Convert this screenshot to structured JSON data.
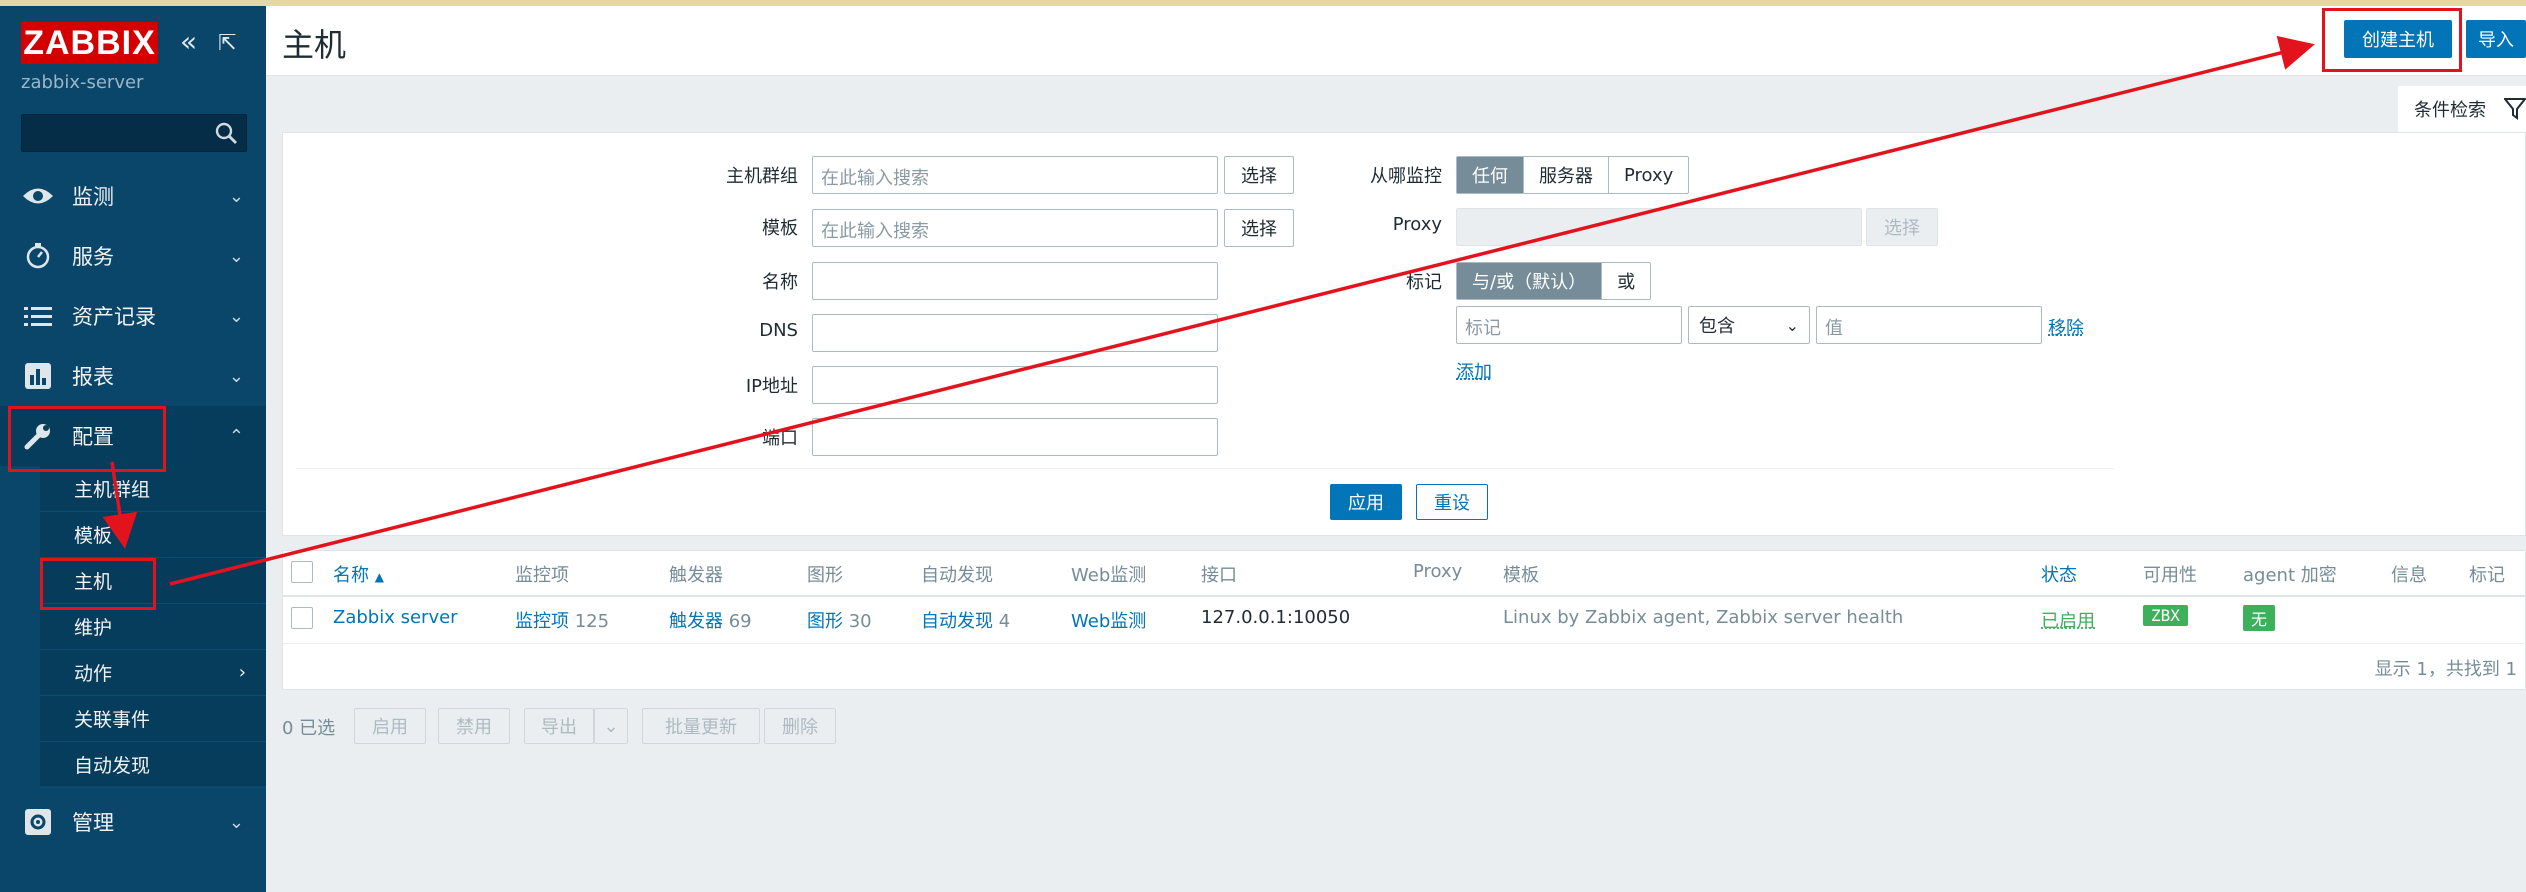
{
  "sidebar": {
    "logo": "ZABBIX",
    "server": "zabbix-server",
    "search": {
      "value": "",
      "placeholder": ""
    },
    "menu": [
      {
        "label": "监测",
        "icon": "eye-icon"
      },
      {
        "label": "服务",
        "icon": "clock-icon"
      },
      {
        "label": "资产记录",
        "icon": "list-icon"
      },
      {
        "label": "报表",
        "icon": "bar-chart-icon"
      },
      {
        "label": "配置",
        "icon": "wrench-icon"
      },
      {
        "label": "管理",
        "icon": "gear-icon"
      }
    ],
    "config_sub": [
      "主机群组",
      "模板",
      "主机",
      "维护",
      "动作",
      "关联事件",
      "自动发现"
    ]
  },
  "header": {
    "title": "主机",
    "create_host": "创建主机",
    "import": "导入"
  },
  "filter": {
    "tab": "条件检索",
    "host_groups_label": "主机群组",
    "templates_label": "模板",
    "name_label": "名称",
    "dns_label": "DNS",
    "ip_label": "IP地址",
    "port_label": "端口",
    "search_placeholder": "在此输入搜索",
    "select": "选择",
    "monitored_by_label": "从哪监控",
    "monitored_by": [
      "任何",
      "服务器",
      "Proxy"
    ],
    "proxy_label": "Proxy",
    "tags_label": "标记",
    "tag_logic": [
      "与/或（默认）",
      "或"
    ],
    "tag_placeholder": "标记",
    "tag_operator": "包含",
    "value_placeholder": "值",
    "remove": "移除",
    "add": "添加",
    "apply": "应用",
    "reset": "重设"
  },
  "table": {
    "columns": [
      "名称",
      "监控项",
      "触发器",
      "图形",
      "自动发现",
      "Web监测",
      "接口",
      "Proxy",
      "模板",
      "状态",
      "可用性",
      "agent 加密",
      "信息",
      "标记"
    ],
    "rows": [
      {
        "name": "Zabbix server",
        "items_label": "监控项",
        "items_count": "125",
        "triggers_label": "触发器",
        "triggers_count": "69",
        "graphs_label": "图形",
        "graphs_count": "30",
        "discovery_label": "自动发现",
        "discovery_count": "4",
        "web": "Web监测",
        "interface": "127.0.0.1:10050",
        "template1": "Linux by Zabbix agent",
        "template_sep": ", ",
        "template2": "Zabbix server health",
        "status": "已启用",
        "availability": "ZBX",
        "encryption": "无"
      }
    ],
    "footer": "显示 1，共找到 1"
  },
  "bulk": {
    "selected": "0 已选",
    "buttons": [
      "启用",
      "禁用",
      "导出",
      "批量更新",
      "删除"
    ]
  },
  "colors": {
    "sidebar": "#0a466a",
    "primary": "#0275b8",
    "annotation": "#e3131e",
    "status_enabled": "#3db05b"
  }
}
